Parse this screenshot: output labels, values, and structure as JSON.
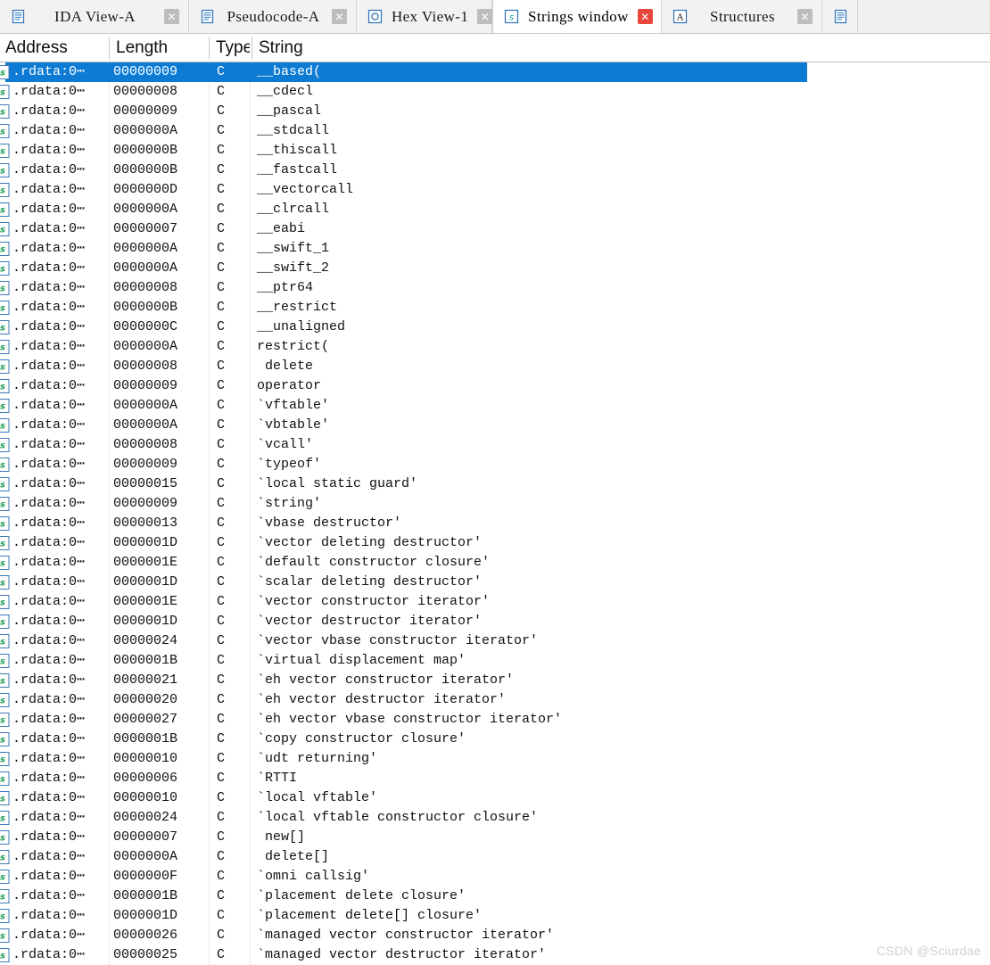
{
  "window": {
    "title": "Strings window",
    "accent_selection": "#0d7bd4",
    "close_active_color": "#e8453c",
    "close_inactive_color": "#bdbdbd"
  },
  "tabs": [
    {
      "label": "IDA View-A",
      "icon": "ida-view-icon",
      "active": false,
      "close_icon": "close-icon"
    },
    {
      "label": "Pseudocode-A",
      "icon": "pseudocode-icon",
      "active": false,
      "close_icon": "close-icon"
    },
    {
      "label": "Hex View-1",
      "icon": "hex-view-icon",
      "active": false,
      "close_icon": "close-icon"
    },
    {
      "label": "Strings window",
      "icon": "strings-window-icon",
      "active": true,
      "close_icon": "close-icon"
    },
    {
      "label": "Structures",
      "icon": "structures-icon",
      "active": false,
      "close_icon": "close-icon"
    }
  ],
  "columns": [
    {
      "key": "address",
      "label": "Address"
    },
    {
      "key": "length",
      "label": "Length"
    },
    {
      "key": "type",
      "label": "Type"
    },
    {
      "key": "string",
      "label": "String"
    }
  ],
  "rows": [
    {
      "icon": "string-item-icon",
      "address": ".rdata:0⋯",
      "length": "00000009",
      "type": "C",
      "string": "__based("
    },
    {
      "icon": "string-item-icon",
      "address": ".rdata:0⋯",
      "length": "00000008",
      "type": "C",
      "string": "__cdecl"
    },
    {
      "icon": "string-item-icon",
      "address": ".rdata:0⋯",
      "length": "00000009",
      "type": "C",
      "string": "__pascal"
    },
    {
      "icon": "string-item-icon",
      "address": ".rdata:0⋯",
      "length": "0000000A",
      "type": "C",
      "string": "__stdcall"
    },
    {
      "icon": "string-item-icon",
      "address": ".rdata:0⋯",
      "length": "0000000B",
      "type": "C",
      "string": "__thiscall"
    },
    {
      "icon": "string-item-icon",
      "address": ".rdata:0⋯",
      "length": "0000000B",
      "type": "C",
      "string": "__fastcall"
    },
    {
      "icon": "string-item-icon",
      "address": ".rdata:0⋯",
      "length": "0000000D",
      "type": "C",
      "string": "__vectorcall"
    },
    {
      "icon": "string-item-icon",
      "address": ".rdata:0⋯",
      "length": "0000000A",
      "type": "C",
      "string": "__clrcall"
    },
    {
      "icon": "string-item-icon",
      "address": ".rdata:0⋯",
      "length": "00000007",
      "type": "C",
      "string": "__eabi"
    },
    {
      "icon": "string-item-icon",
      "address": ".rdata:0⋯",
      "length": "0000000A",
      "type": "C",
      "string": "__swift_1"
    },
    {
      "icon": "string-item-icon",
      "address": ".rdata:0⋯",
      "length": "0000000A",
      "type": "C",
      "string": "__swift_2"
    },
    {
      "icon": "string-item-icon",
      "address": ".rdata:0⋯",
      "length": "00000008",
      "type": "C",
      "string": "__ptr64"
    },
    {
      "icon": "string-item-icon",
      "address": ".rdata:0⋯",
      "length": "0000000B",
      "type": "C",
      "string": "__restrict"
    },
    {
      "icon": "string-item-icon",
      "address": ".rdata:0⋯",
      "length": "0000000C",
      "type": "C",
      "string": "__unaligned"
    },
    {
      "icon": "string-item-icon",
      "address": ".rdata:0⋯",
      "length": "0000000A",
      "type": "C",
      "string": "restrict("
    },
    {
      "icon": "string-item-icon",
      "address": ".rdata:0⋯",
      "length": "00000008",
      "type": "C",
      "string": " delete"
    },
    {
      "icon": "string-item-icon",
      "address": ".rdata:0⋯",
      "length": "00000009",
      "type": "C",
      "string": "operator"
    },
    {
      "icon": "string-item-icon",
      "address": ".rdata:0⋯",
      "length": "0000000A",
      "type": "C",
      "string": "`vftable'"
    },
    {
      "icon": "string-item-icon",
      "address": ".rdata:0⋯",
      "length": "0000000A",
      "type": "C",
      "string": "`vbtable'"
    },
    {
      "icon": "string-item-icon",
      "address": ".rdata:0⋯",
      "length": "00000008",
      "type": "C",
      "string": "`vcall'"
    },
    {
      "icon": "string-item-icon",
      "address": ".rdata:0⋯",
      "length": "00000009",
      "type": "C",
      "string": "`typeof'"
    },
    {
      "icon": "string-item-icon",
      "address": ".rdata:0⋯",
      "length": "00000015",
      "type": "C",
      "string": "`local static guard'"
    },
    {
      "icon": "string-item-icon",
      "address": ".rdata:0⋯",
      "length": "00000009",
      "type": "C",
      "string": "`string'"
    },
    {
      "icon": "string-item-icon",
      "address": ".rdata:0⋯",
      "length": "00000013",
      "type": "C",
      "string": "`vbase destructor'"
    },
    {
      "icon": "string-item-icon",
      "address": ".rdata:0⋯",
      "length": "0000001D",
      "type": "C",
      "string": "`vector deleting destructor'"
    },
    {
      "icon": "string-item-icon",
      "address": ".rdata:0⋯",
      "length": "0000001E",
      "type": "C",
      "string": "`default constructor closure'"
    },
    {
      "icon": "string-item-icon",
      "address": ".rdata:0⋯",
      "length": "0000001D",
      "type": "C",
      "string": "`scalar deleting destructor'"
    },
    {
      "icon": "string-item-icon",
      "address": ".rdata:0⋯",
      "length": "0000001E",
      "type": "C",
      "string": "`vector constructor iterator'"
    },
    {
      "icon": "string-item-icon",
      "address": ".rdata:0⋯",
      "length": "0000001D",
      "type": "C",
      "string": "`vector destructor iterator'"
    },
    {
      "icon": "string-item-icon",
      "address": ".rdata:0⋯",
      "length": "00000024",
      "type": "C",
      "string": "`vector vbase constructor iterator'"
    },
    {
      "icon": "string-item-icon",
      "address": ".rdata:0⋯",
      "length": "0000001B",
      "type": "C",
      "string": "`virtual displacement map'"
    },
    {
      "icon": "string-item-icon",
      "address": ".rdata:0⋯",
      "length": "00000021",
      "type": "C",
      "string": "`eh vector constructor iterator'"
    },
    {
      "icon": "string-item-icon",
      "address": ".rdata:0⋯",
      "length": "00000020",
      "type": "C",
      "string": "`eh vector destructor iterator'"
    },
    {
      "icon": "string-item-icon",
      "address": ".rdata:0⋯",
      "length": "00000027",
      "type": "C",
      "string": "`eh vector vbase constructor iterator'"
    },
    {
      "icon": "string-item-icon",
      "address": ".rdata:0⋯",
      "length": "0000001B",
      "type": "C",
      "string": "`copy constructor closure'"
    },
    {
      "icon": "string-item-icon",
      "address": ".rdata:0⋯",
      "length": "00000010",
      "type": "C",
      "string": "`udt returning'"
    },
    {
      "icon": "string-item-icon",
      "address": ".rdata:0⋯",
      "length": "00000006",
      "type": "C",
      "string": "`RTTI"
    },
    {
      "icon": "string-item-icon",
      "address": ".rdata:0⋯",
      "length": "00000010",
      "type": "C",
      "string": "`local vftable'"
    },
    {
      "icon": "string-item-icon",
      "address": ".rdata:0⋯",
      "length": "00000024",
      "type": "C",
      "string": "`local vftable constructor closure'"
    },
    {
      "icon": "string-item-icon",
      "address": ".rdata:0⋯",
      "length": "00000007",
      "type": "C",
      "string": " new[]"
    },
    {
      "icon": "string-item-icon",
      "address": ".rdata:0⋯",
      "length": "0000000A",
      "type": "C",
      "string": " delete[]"
    },
    {
      "icon": "string-item-icon",
      "address": ".rdata:0⋯",
      "length": "0000000F",
      "type": "C",
      "string": "`omni callsig'"
    },
    {
      "icon": "string-item-icon",
      "address": ".rdata:0⋯",
      "length": "0000001B",
      "type": "C",
      "string": "`placement delete closure'"
    },
    {
      "icon": "string-item-icon",
      "address": ".rdata:0⋯",
      "length": "0000001D",
      "type": "C",
      "string": "`placement delete[] closure'"
    },
    {
      "icon": "string-item-icon",
      "address": ".rdata:0⋯",
      "length": "00000026",
      "type": "C",
      "string": "`managed vector constructor iterator'"
    },
    {
      "icon": "string-item-icon",
      "address": ".rdata:0⋯",
      "length": "00000025",
      "type": "C",
      "string": "`managed vector destructor iterator'"
    }
  ],
  "selected_row_index": 0,
  "watermark": "CSDN @Sciurdae"
}
